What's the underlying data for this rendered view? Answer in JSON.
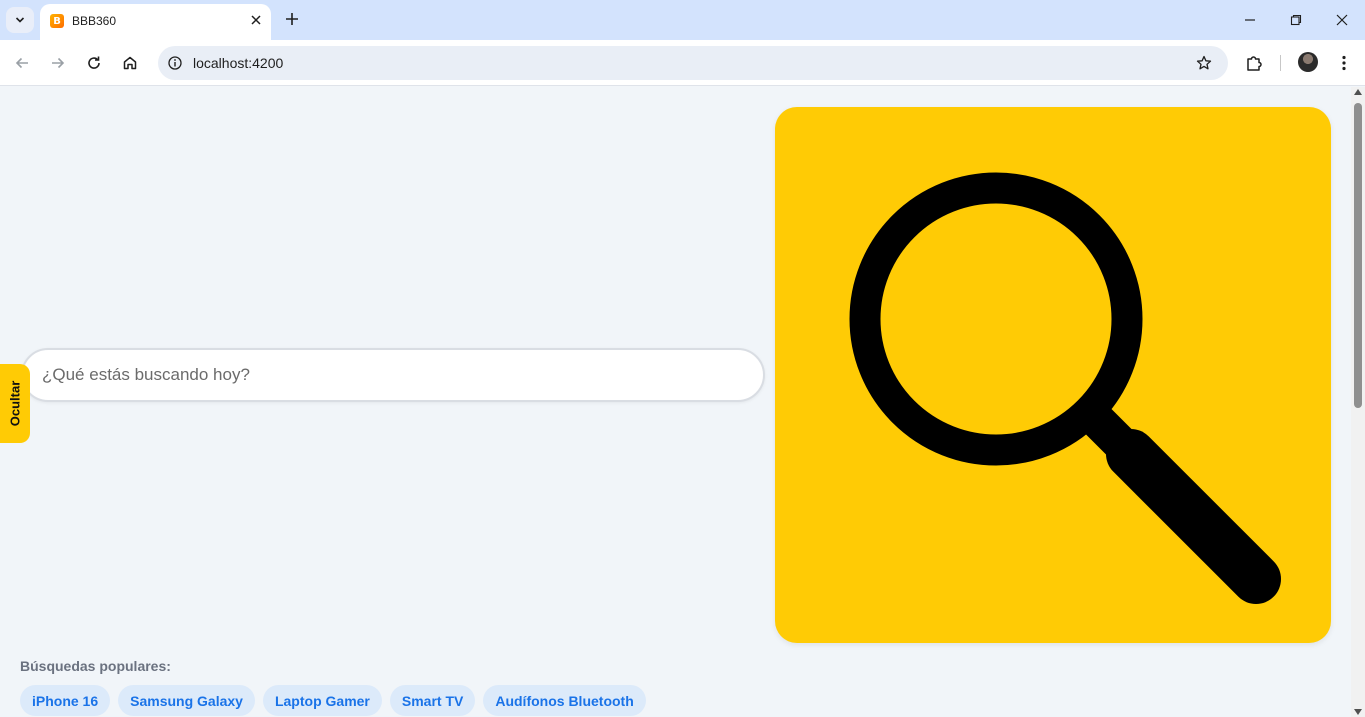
{
  "browser": {
    "tab_title": "BBB360",
    "url": "localhost:4200",
    "favicon_letter": "B"
  },
  "page": {
    "search_placeholder": "¿Qué estás buscando hoy?",
    "hide_label": "Ocultar",
    "popular_label": "Búsquedas populares:",
    "popular_searches": [
      "iPhone 16",
      "Samsung Galaxy",
      "Laptop Gamer",
      "Smart TV",
      "Audífonos Bluetooth"
    ],
    "hero_icon": "magnifying-glass-icon"
  },
  "colors": {
    "accent_yellow": "#ffcb05",
    "chip_bg": "#dceafa",
    "chip_text": "#1a73e8",
    "page_bg": "#f1f5f9"
  }
}
